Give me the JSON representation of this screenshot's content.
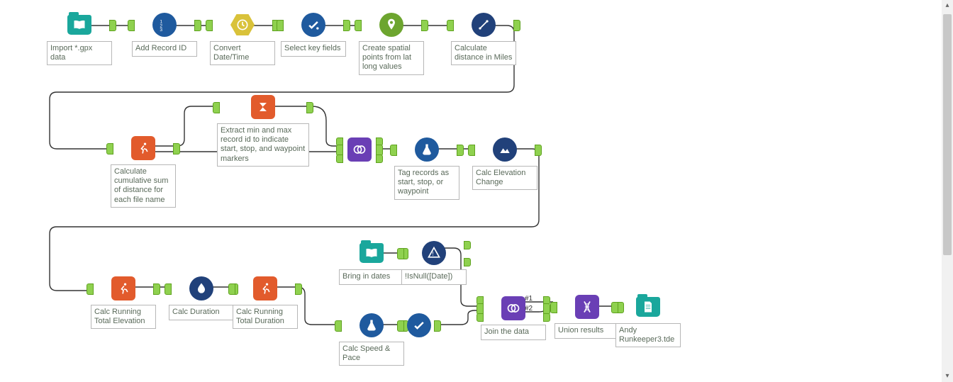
{
  "nodes": {
    "n1": {
      "label": "Import *.gpx data",
      "icon": "book-open",
      "shape": "folder",
      "color": "teal"
    },
    "n2": {
      "label": "Add Record ID",
      "icon": "list-123",
      "shape": "circle",
      "color": "blue"
    },
    "n3": {
      "label": "Convert Date/Time",
      "icon": "clock",
      "shape": "hex",
      "color": "yellow"
    },
    "n4": {
      "label": "Select key fields",
      "icon": "check",
      "shape": "circle",
      "color": "blue"
    },
    "n5": {
      "label": "Create spatial points from lat long values",
      "icon": "pin",
      "shape": "circle",
      "color": "green"
    },
    "n6": {
      "label": "Calculate distance in Miles",
      "icon": "distance",
      "shape": "circle",
      "color": "navy"
    },
    "n7": {
      "label": "Calculate cumulative sum of distance for each file name",
      "icon": "runner",
      "shape": "square",
      "color": "orange"
    },
    "n8": {
      "label": "Extract min and max record id to indicate start, stop, and waypoint markers",
      "icon": "sigma",
      "shape": "square",
      "color": "orange"
    },
    "n9": {
      "label": "",
      "icon": "join",
      "shape": "square",
      "color": "purple"
    },
    "n10": {
      "label": "Tag records as start, stop, or waypoint",
      "icon": "flask",
      "shape": "circle",
      "color": "blue"
    },
    "n11": {
      "label": "Calc Elevation Change",
      "icon": "elevation",
      "shape": "circle",
      "color": "navy"
    },
    "n12": {
      "label": "Calc Running Total Elevation",
      "icon": "runner",
      "shape": "square",
      "color": "orange"
    },
    "n13": {
      "label": "Calc Duration",
      "icon": "drop",
      "shape": "circle",
      "color": "navy"
    },
    "n14": {
      "label": "Calc Running Total Duration",
      "icon": "runner",
      "shape": "square",
      "color": "orange"
    },
    "n15": {
      "label": "Bring in dates",
      "icon": "book-open",
      "shape": "folder",
      "color": "teal"
    },
    "n16": {
      "label": "!IsNull([Date])",
      "icon": "filter",
      "shape": "circle",
      "color": "navy"
    },
    "n17": {
      "label": "Calc Speed & Pace",
      "icon": "flask",
      "shape": "circle",
      "color": "blue"
    },
    "n18": {
      "label": "",
      "icon": "check",
      "shape": "circle",
      "color": "blue"
    },
    "n19": {
      "label": "Join the data",
      "icon": "join",
      "shape": "square",
      "color": "purple"
    },
    "n20": {
      "label": "Union results",
      "icon": "dna",
      "shape": "square",
      "color": "purple"
    },
    "n21": {
      "label": "Andy Runkeeper3.tde",
      "icon": "doc",
      "shape": "folder",
      "color": "teal"
    }
  },
  "edge_labels": {
    "e19a": "#1",
    "e19b": "#2"
  }
}
